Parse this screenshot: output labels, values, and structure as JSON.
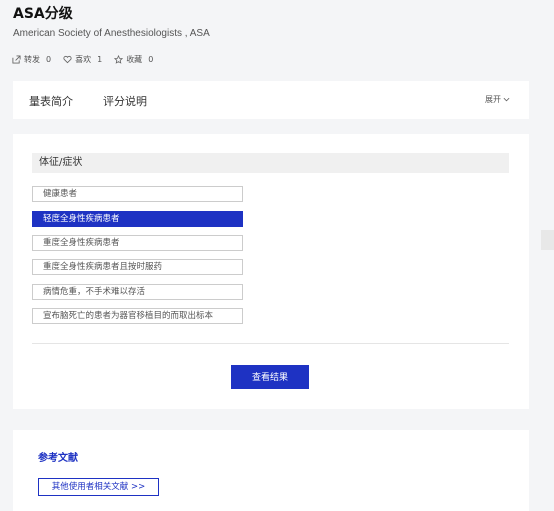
{
  "header": {
    "title": "ASA分级",
    "subtitle": "American Society of Anesthesiologists , ASA",
    "stats": {
      "share_label": "转发",
      "share_count": "0",
      "like_label": "喜欢",
      "like_count": "1",
      "fav_label": "收藏",
      "fav_count": "0"
    }
  },
  "tabs": {
    "intro": "量表简介",
    "scoring": "评分说明",
    "expand": "展开"
  },
  "form": {
    "section_title": "体征/症状",
    "options": [
      "健康患者",
      "轻度全身性疾病患者",
      "重度全身性疾病患者",
      "重度全身性疾病患者且按时服药",
      "病情危重，不手术难以存活",
      "宣布脑死亡的患者为器官移植目的而取出标本"
    ],
    "selected_index": 1,
    "result_button": "查看结果"
  },
  "references": {
    "title": "参考文献",
    "more_button": "其他使用者相关文献 >>"
  },
  "colors": {
    "accent": "#1e32c3",
    "background": "#f4f5f7"
  },
  "icons": {
    "share": "share-icon",
    "like": "heart-icon",
    "fav": "star-icon",
    "expand": "chevron-down-icon"
  }
}
